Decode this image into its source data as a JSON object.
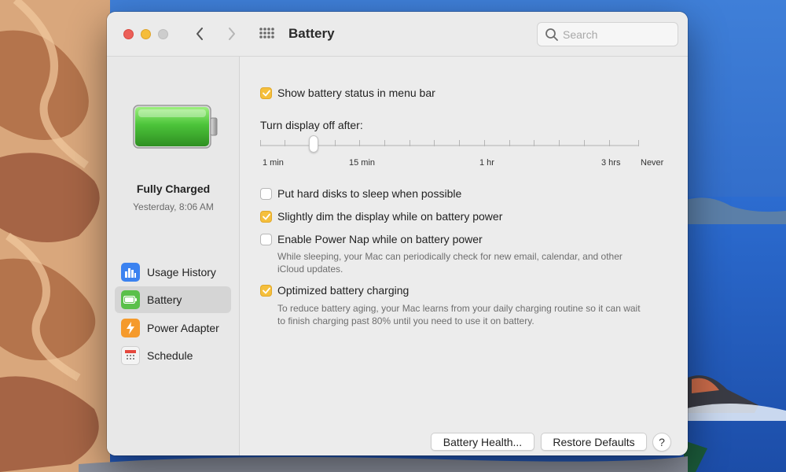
{
  "window": {
    "title": "Battery"
  },
  "search": {
    "placeholder": "Search"
  },
  "sidebar": {
    "status": "Fully Charged",
    "timestamp": "Yesterday, 8:06 AM",
    "items": [
      {
        "label": "Usage History",
        "icon": "bar-chart-icon",
        "active": false
      },
      {
        "label": "Battery",
        "icon": "battery-icon",
        "active": true
      },
      {
        "label": "Power Adapter",
        "icon": "lightning-icon",
        "active": false
      },
      {
        "label": "Schedule",
        "icon": "calendar-icon",
        "active": false
      }
    ]
  },
  "settings": {
    "show_status": {
      "label": "Show battery status in menu bar",
      "checked": true
    },
    "display_off_label": "Turn display off after:",
    "slider": {
      "labels": [
        "1 min",
        "15 min",
        "1 hr",
        "3 hrs",
        "Never"
      ],
      "value": "2 min"
    },
    "hard_disks": {
      "label": "Put hard disks to sleep when possible",
      "checked": false
    },
    "dim_display": {
      "label": "Slightly dim the display while on battery power",
      "checked": true
    },
    "power_nap": {
      "label": "Enable Power Nap while on battery power",
      "checked": false,
      "help_line1": "While sleeping, your Mac can periodically check for new email, calendar, and other",
      "help_line2": "iCloud updates."
    },
    "optimized_charging": {
      "label": "Optimized battery charging",
      "checked": true,
      "help_line1": "To reduce battery aging, your Mac learns from your daily charging routine so it can wait",
      "help_line2": "to finish charging past 80% until you need to use it on battery."
    }
  },
  "buttons": {
    "battery_health": "Battery Health...",
    "restore_defaults": "Restore Defaults",
    "help": "?"
  },
  "colors": {
    "checkbox_accent": "#f5bf3c",
    "battery_green": "#4cc43a",
    "close": "#ec5f58",
    "minimize": "#f5bd3a"
  }
}
